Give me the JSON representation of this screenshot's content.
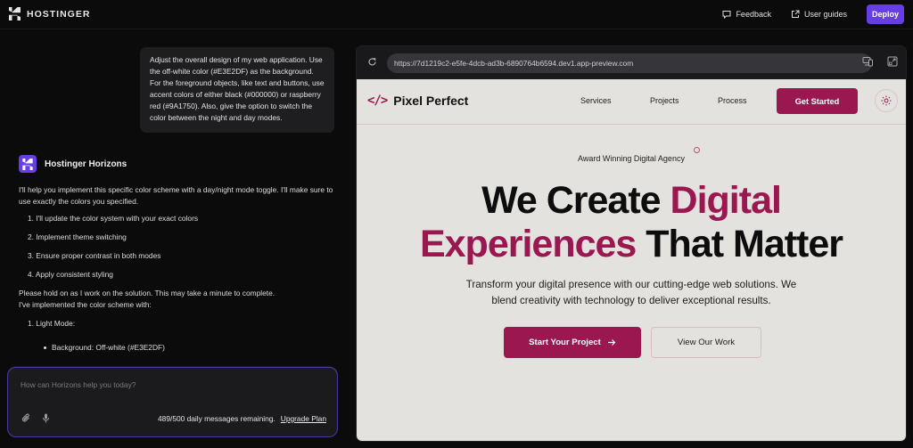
{
  "topbar": {
    "brand": "HOSTINGER",
    "feedback_label": "Feedback",
    "user_guides_label": "User guides",
    "deploy_label": "Deploy"
  },
  "chat": {
    "user_message": "Adjust the overall design of my web application. Use the off-white color (#E3E2DF) as the background. For the foreground objects, like text and buttons, use accent colors of either black (#000000) or raspberry red (#9A1750). Also, give the option to switch the color between the night and day modes.",
    "assistant_name": "Hostinger Horizons",
    "intro": "I'll help you implement this specific color scheme with a day/night mode toggle. I'll make sure to use exactly the colors you specified.",
    "steps": [
      "1. I'll update the color system with your exact colors",
      "2. Implement theme switching",
      "3. Ensure proper contrast in both modes",
      "4. Apply consistent styling"
    ],
    "hold_on": "Please hold on as I work on the solution. This may take a minute to complete.",
    "implemented": "I've implemented the color scheme with:",
    "modes": [
      "1. Light Mode:"
    ],
    "light_mode_items": [
      "Background: Off-white (#E3E2DF)"
    ]
  },
  "composer": {
    "placeholder": "How can Horizons help you today?",
    "value": "",
    "remaining": "489/500 daily messages remaining.",
    "upgrade_label": "Upgrade Plan"
  },
  "preview": {
    "url": "https://7d1219c2-e5fe-4dcb-ad3b-6890764b6594.dev1.app-preview.com",
    "site": {
      "logo_glyph": "</>",
      "logo_text": "Pixel Perfect",
      "nav": [
        "Services",
        "Projects",
        "Process"
      ],
      "cta": "Get Started",
      "badge": "Award Winning Digital Agency",
      "title_part1": "We Create ",
      "title_accent1": "Digital",
      "title_accent2": "Experiences",
      "title_part2": " That Matter",
      "subtitle_line1": "Transform your digital presence with our cutting-edge web solutions. We",
      "subtitle_line2": "blend creativity with technology to deliver exceptional results.",
      "primary_button": "Start Your Project",
      "secondary_button": "View Our Work"
    }
  },
  "colors": {
    "accent_purple": "#673de6",
    "raspberry": "#9a1750",
    "off_white": "#e3e2df"
  }
}
